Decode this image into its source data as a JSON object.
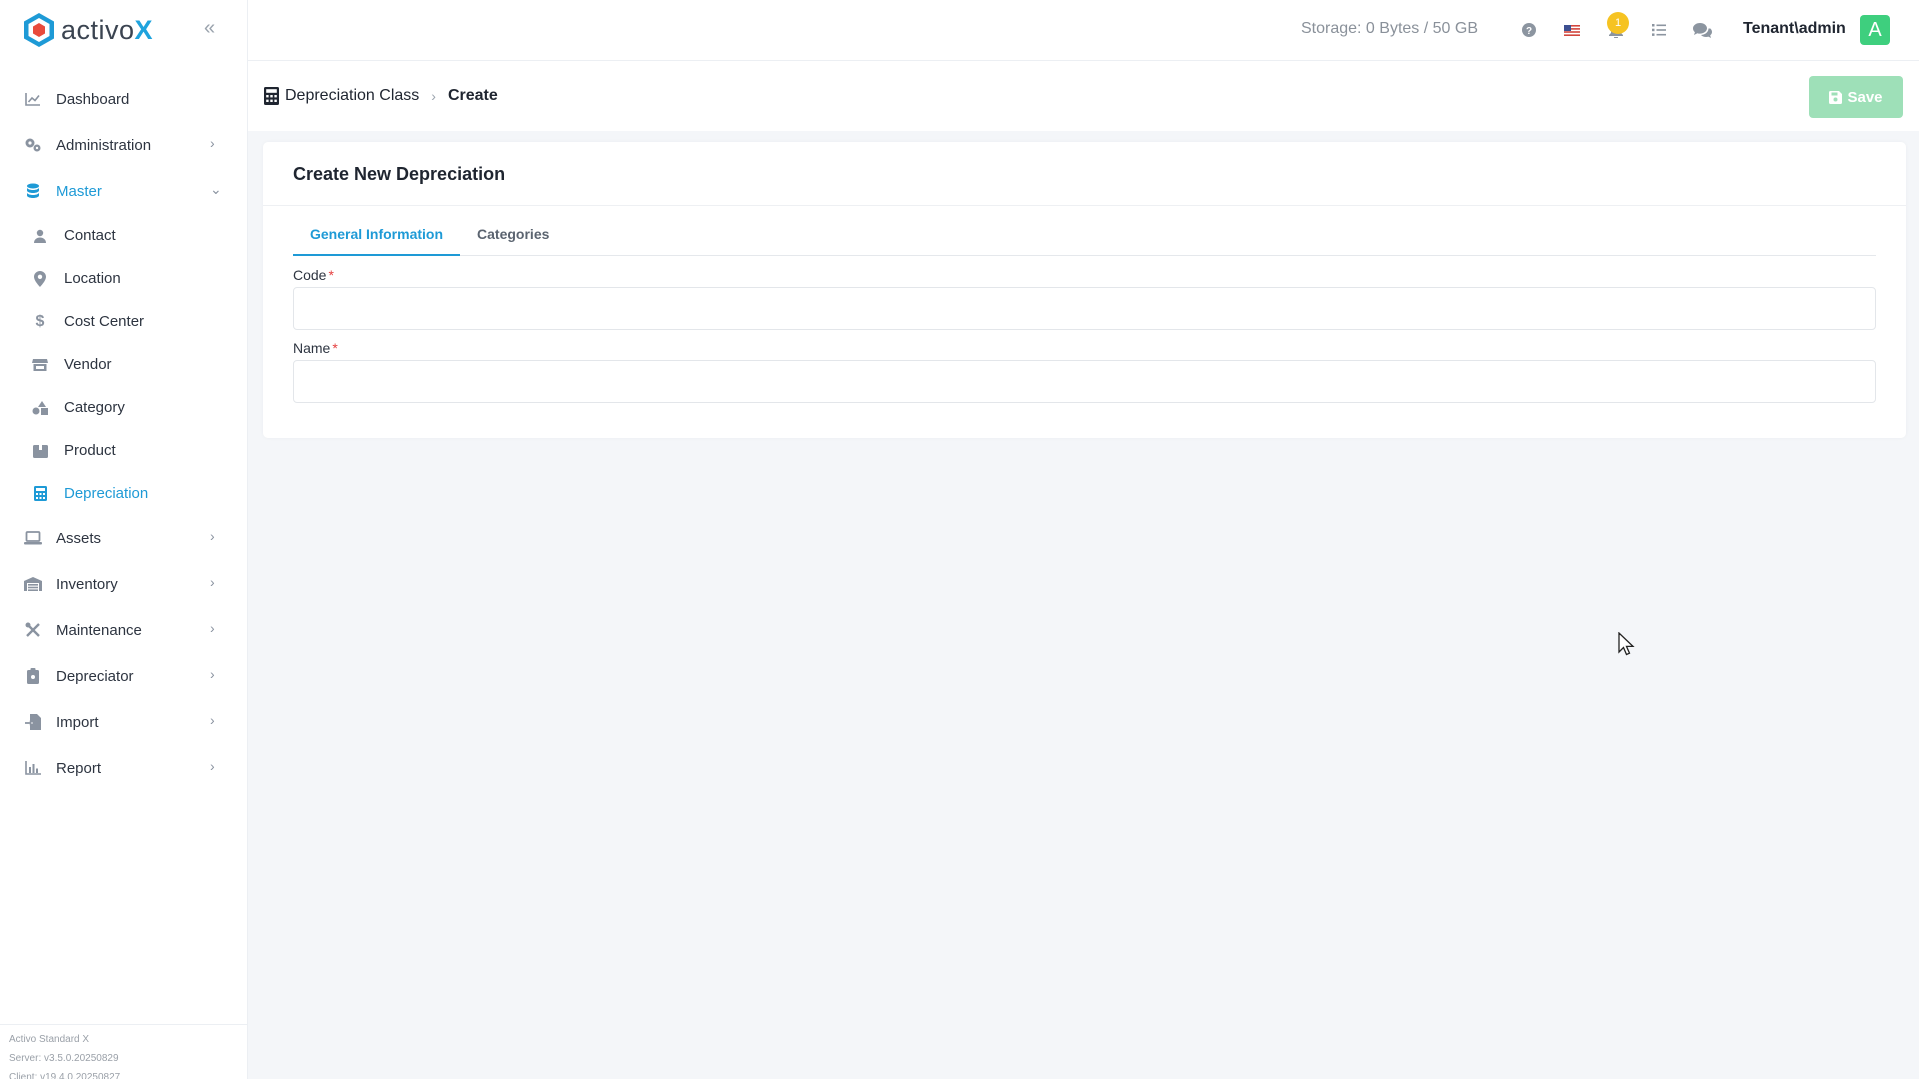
{
  "app": {
    "brand_name": "activo",
    "brand_suffix": "X",
    "brand_colors": {
      "primary": "#1e9ad6",
      "danger_red": "#e53e3e",
      "success_green": "#3ecf7e"
    }
  },
  "sidebar": {
    "items": [
      {
        "label": "Dashboard",
        "icon": "chart-line-icon"
      },
      {
        "label": "Administration",
        "icon": "cogs-icon"
      },
      {
        "label": "Master",
        "icon": "database-icon"
      },
      {
        "label": "Assets",
        "icon": "laptop-icon"
      },
      {
        "label": "Inventory",
        "icon": "warehouse-icon"
      },
      {
        "label": "Maintenance",
        "icon": "tools-icon"
      },
      {
        "label": "Depreciator",
        "icon": "clipboard-icon"
      },
      {
        "label": "Import",
        "icon": "file-import-icon"
      },
      {
        "label": "Report",
        "icon": "chart-bar-icon"
      }
    ],
    "master_sub_items": [
      {
        "label": "Contact",
        "icon": "user-icon"
      },
      {
        "label": "Location",
        "icon": "map-marker-icon"
      },
      {
        "label": "Cost Center",
        "icon": "dollar-icon"
      },
      {
        "label": "Vendor",
        "icon": "store-icon"
      },
      {
        "label": "Category",
        "icon": "shapes-icon"
      },
      {
        "label": "Product",
        "icon": "box-icon"
      },
      {
        "label": "Depreciation",
        "icon": "calculator-icon"
      }
    ],
    "footer": {
      "product": "Activo Standard X",
      "server": "Server: v3.5.0.20250829",
      "client": "Client: v19.4.0.20250827"
    }
  },
  "topbar": {
    "storage": "Storage: 0 Bytes / 50 GB",
    "notification_count": "1",
    "user": "Tenant\\admin",
    "avatar_letter": "A"
  },
  "subheader": {
    "breadcrumb_parent": "Depreciation Class",
    "breadcrumb_current": "Create",
    "save_label": "Save"
  },
  "card": {
    "title": "Create New Depreciation",
    "tabs": [
      {
        "label": "General Information"
      },
      {
        "label": "Categories"
      }
    ],
    "fields": {
      "code_label": "Code",
      "code_value": "",
      "name_label": "Name",
      "name_value": "",
      "required_mark": "*"
    }
  }
}
